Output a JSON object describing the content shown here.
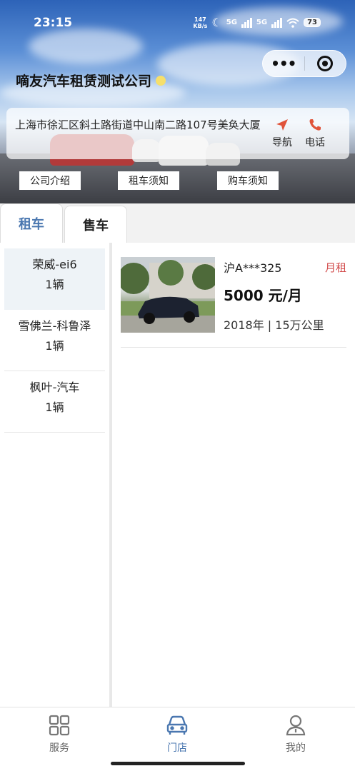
{
  "status_bar": {
    "time": "23:15",
    "net_speed_value": "147",
    "net_speed_unit": "KB/s",
    "sim1": "5G",
    "sim2": "5G",
    "battery": "73"
  },
  "header": {
    "company_name": "嘀友汽车租赁测试公司",
    "address": "上海市徐汇区斜土路街道中山南二路107号美奂大厦",
    "nav_label": "导航",
    "phone_label": "电话",
    "links": [
      "公司介绍",
      "租车须知",
      "购车须知"
    ]
  },
  "tabs": [
    {
      "label": "租车",
      "active": true
    },
    {
      "label": "售车",
      "active": false
    }
  ],
  "categories": [
    {
      "name": "荣威-ei6",
      "count": "1辆",
      "selected": true
    },
    {
      "name": "雪佛兰-科鲁泽",
      "count": "1辆",
      "selected": false
    },
    {
      "name": "枫叶-汽车",
      "count": "1辆",
      "selected": false
    }
  ],
  "listing": {
    "plate": "沪A***325",
    "rent_type": "月租",
    "price": "5000 元/月",
    "meta": "2018年 | 15万公里"
  },
  "bottom_nav": [
    {
      "label": "服务",
      "icon": "grid-icon",
      "active": false
    },
    {
      "label": "门店",
      "icon": "car-icon",
      "active": true
    },
    {
      "label": "我的",
      "icon": "user-icon",
      "active": false
    }
  ],
  "colors": {
    "accent": "#4a77b0",
    "rent_tag": "#d24a4a",
    "selected_bg": "#eef3f7",
    "nav_arrow": "#e0533a"
  }
}
